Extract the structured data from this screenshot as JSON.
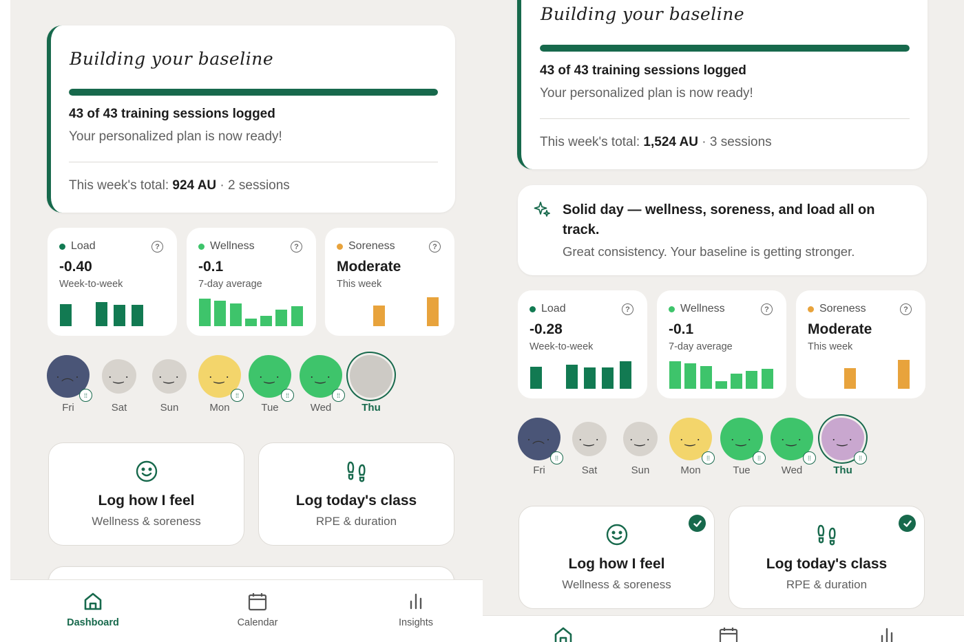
{
  "colors": {
    "accent": "#17694c",
    "load": "#127a52",
    "wellness": "#3ec46b",
    "soreness": "#e8a33c",
    "background": "#f1efec"
  },
  "left": {
    "baseline": {
      "title": "Building your baseline",
      "progress": 1.0,
      "sessions_logged": "43 of 43 training sessions logged",
      "plan_ready": "Your personalized plan is now ready!",
      "week_total_label": "This week's total:",
      "week_total_value": "924 AU",
      "week_total_sessions": "· 2 sessions"
    },
    "metrics": [
      {
        "label": "Load",
        "value": "-0.40",
        "sub": "Week-to-week",
        "bars": [
          0.72,
          0,
          0.8,
          0.7,
          0.7
        ],
        "color_key": "load"
      },
      {
        "label": "Wellness",
        "value": "-0.1",
        "sub": "7-day average",
        "bars": [
          0.9,
          0.85,
          0.75,
          0.25,
          0.35,
          0.55,
          0.65
        ],
        "color_key": "wellness"
      },
      {
        "label": "Soreness",
        "value": "Moderate",
        "sub": "This week",
        "bars": [
          0,
          0,
          0.68,
          0,
          0,
          0.95
        ],
        "color_key": "soreness"
      }
    ],
    "days": [
      {
        "label": "Fri",
        "color": "#4a5577",
        "face": "·︵·",
        "badge": true,
        "active": false
      },
      {
        "label": "Sat",
        "color": "#d7d3cd",
        "face": "·‿·",
        "badge": false,
        "active": false
      },
      {
        "label": "Sun",
        "color": "#d7d3cd",
        "face": "·‿·",
        "badge": false,
        "active": false
      },
      {
        "label": "Mon",
        "color": "#f3d56b",
        "face": "·‿·",
        "badge": true,
        "active": false
      },
      {
        "label": "Tue",
        "color": "#3ec46b",
        "face": "·‿·",
        "badge": true,
        "active": false
      },
      {
        "label": "Wed",
        "color": "#3ec46b",
        "face": "·‿·",
        "badge": true,
        "active": false
      },
      {
        "label": "Thu",
        "color": "#cdcac5",
        "face": "",
        "badge": false,
        "active": true
      }
    ],
    "actions": [
      {
        "title": "Log how I feel",
        "sub": "Wellness & soreness",
        "icon": "smiley-icon",
        "checked": false
      },
      {
        "title": "Log today's class",
        "sub": "RPE & duration",
        "icon": "footprints-icon",
        "checked": false
      }
    ],
    "nav": [
      {
        "label": "Dashboard",
        "icon": "home-icon",
        "active": true
      },
      {
        "label": "Calendar",
        "icon": "calendar-icon",
        "active": false
      },
      {
        "label": "Insights",
        "icon": "bar-chart-icon",
        "active": false
      }
    ]
  },
  "right": {
    "baseline": {
      "title": "Building your baseline",
      "progress": 1.0,
      "sessions_logged": "43 of 43 training sessions logged",
      "plan_ready": "Your personalized plan is now ready!",
      "week_total_label": "This week's total:",
      "week_total_value": "1,524 AU",
      "week_total_sessions": "· 3 sessions"
    },
    "insight": {
      "icon": "sparkle-icon",
      "title": "Solid day — wellness, soreness, and load all on track.",
      "sub": "Great consistency. Your baseline is getting stronger."
    },
    "metrics": [
      {
        "label": "Load",
        "value": "-0.28",
        "sub": "Week-to-week",
        "bars": [
          0.72,
          0,
          0.8,
          0.7,
          0.7,
          0.9
        ],
        "color_key": "load"
      },
      {
        "label": "Wellness",
        "value": "-0.1",
        "sub": "7-day average",
        "bars": [
          0.9,
          0.85,
          0.75,
          0.25,
          0.5,
          0.6,
          0.65
        ],
        "color_key": "wellness"
      },
      {
        "label": "Soreness",
        "value": "Moderate",
        "sub": "This week",
        "bars": [
          0,
          0,
          0.68,
          0,
          0,
          0.95
        ],
        "color_key": "soreness"
      }
    ],
    "days": [
      {
        "label": "Fri",
        "color": "#4a5577",
        "face": "·︵·",
        "badge": true,
        "active": false
      },
      {
        "label": "Sat",
        "color": "#d7d3cd",
        "face": "·‿·",
        "badge": false,
        "active": false
      },
      {
        "label": "Sun",
        "color": "#d7d3cd",
        "face": "·‿·",
        "badge": false,
        "active": false
      },
      {
        "label": "Mon",
        "color": "#f3d56b",
        "face": "·‿·",
        "badge": true,
        "active": false
      },
      {
        "label": "Tue",
        "color": "#3ec46b",
        "face": "·‿·",
        "badge": true,
        "active": false
      },
      {
        "label": "Wed",
        "color": "#3ec46b",
        "face": "·‿·",
        "badge": true,
        "active": false
      },
      {
        "label": "Thu",
        "color": "#c9a7cf",
        "face": "·‿·",
        "badge": true,
        "active": true
      }
    ],
    "actions": [
      {
        "title": "Log how I feel",
        "sub": "Wellness & soreness",
        "icon": "smiley-icon",
        "checked": true
      },
      {
        "title": "Log today's class",
        "sub": "RPE & duration",
        "icon": "footprints-icon",
        "checked": true
      }
    ],
    "nav": [
      {
        "label": "",
        "icon": "home-icon",
        "active": true
      },
      {
        "label": "",
        "icon": "calendar-icon",
        "active": false
      },
      {
        "label": "",
        "icon": "bar-chart-icon",
        "active": false
      }
    ]
  }
}
